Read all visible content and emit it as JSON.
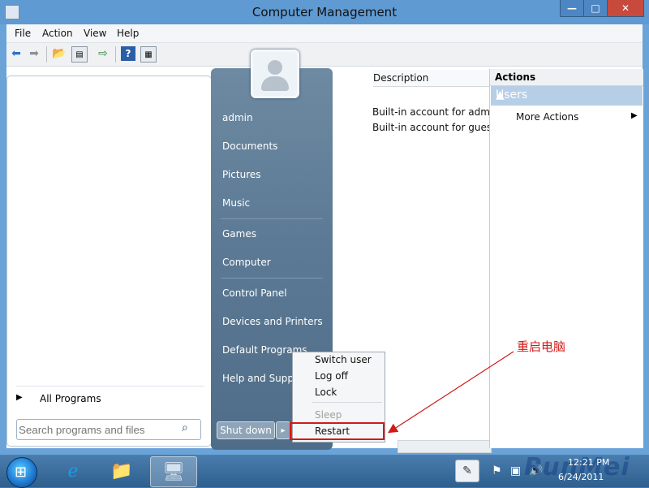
{
  "window": {
    "title": "Computer Management",
    "controls": {
      "minimize": "—",
      "maximize": "□",
      "close": "✕"
    }
  },
  "menubar": {
    "items": [
      "File",
      "Action",
      "View",
      "Help"
    ]
  },
  "toolbar": {
    "icons": [
      "back-arrow-icon",
      "forward-arrow-icon",
      "up-folder-icon",
      "show-hide-tree-icon",
      "export-list-icon",
      "help-icon",
      "properties-icon"
    ]
  },
  "content": {
    "column_header": "Description",
    "rows": [
      "Built-in account for admin",
      "Built-in account for guest"
    ]
  },
  "actions_pane": {
    "header": "Actions",
    "section": "Users",
    "items": [
      "More Actions"
    ]
  },
  "start_menu": {
    "right_items": [
      "admin",
      "Documents",
      "Pictures",
      "Music",
      "Games",
      "Computer",
      "Control Panel",
      "Devices and Printers",
      "Default Programs",
      "Help and Support"
    ],
    "all_programs": "All Programs",
    "search_placeholder": "Search programs and files",
    "shutdown_label": "Shut down",
    "shutdown_arrow": "▸"
  },
  "shutdown_menu": {
    "items": [
      "Switch user",
      "Log off",
      "Lock",
      "Sleep",
      "Restart"
    ],
    "disabled": [
      "Sleep"
    ],
    "highlighted": "Restart"
  },
  "annotation": {
    "text": "重启电脑",
    "color": "#d11a1a"
  },
  "taskbar": {
    "apps": [
      "start-orb",
      "internet-explorer-icon",
      "windows-explorer-icon",
      "computer-management-icon"
    ],
    "clock_time": "12:21 PM",
    "clock_date": "6/24/2011",
    "watermark": "RunMei"
  },
  "colors": {
    "titlebar": "#5f9ad2",
    "start_right_panel": "#5c7a95",
    "actions_section": "#b7cfe6",
    "highlight_box": "#d11a1a"
  }
}
